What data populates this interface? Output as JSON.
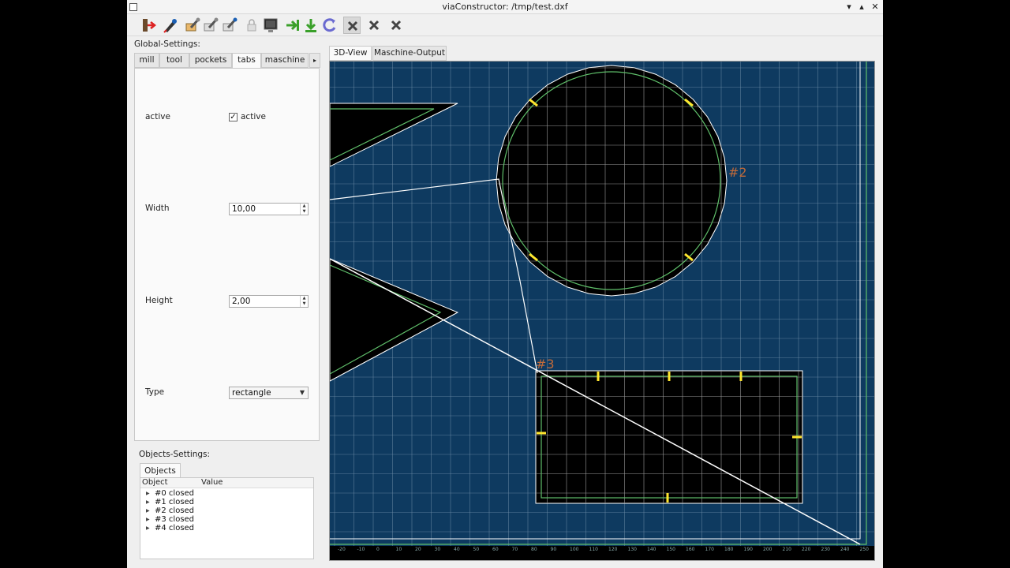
{
  "window": {
    "title": "viaConstructor: /tmp/test.dxf"
  },
  "toolbar": {
    "buttons": [
      "exit-icon",
      "edit-icon",
      "tool-pen-icon",
      "tool-pen-icon",
      "tool-pen-icon",
      "lock-icon",
      "monitor-icon",
      "arrow-right-icon",
      "download-icon",
      "reload-icon",
      "close-icon",
      "close-icon",
      "close-icon"
    ]
  },
  "global": {
    "label": "Global-Settings:",
    "tabs": [
      "mill",
      "tool",
      "pockets",
      "tabs",
      "maschine"
    ],
    "active_tab": "tabs",
    "active_label": "active",
    "active_checkbox_label": "active",
    "active_checked": true,
    "width_label": "Width",
    "width_value": "10,00",
    "height_label": "Height",
    "height_value": "2,00",
    "type_label": "Type",
    "type_value": "rectangle"
  },
  "objects": {
    "label": "Objects-Settings:",
    "tab": "Objects",
    "columns": [
      "Object",
      "Value"
    ],
    "rows": [
      "#0 closed",
      "#1 closed",
      "#2 closed",
      "#3 closed",
      "#4 closed"
    ]
  },
  "view": {
    "tabs": [
      "3D-View",
      "Maschine-Output"
    ],
    "active_tab": "3D-View",
    "labels": {
      "circle": "#2",
      "rect": "#3"
    },
    "axis_ticks": [
      "-20",
      "-10",
      "0",
      "10",
      "20",
      "30",
      "40",
      "50",
      "60",
      "70",
      "80",
      "90",
      "100",
      "110",
      "120",
      "130",
      "140",
      "150",
      "160",
      "170",
      "180",
      "190",
      "200",
      "210",
      "220",
      "230",
      "240",
      "250"
    ],
    "colors": {
      "background": "#0e3a60",
      "grid": "#6f8ea8",
      "toolpath": "#5fbf6a",
      "tab": "#ffe62e",
      "label": "#c06a3a"
    }
  }
}
